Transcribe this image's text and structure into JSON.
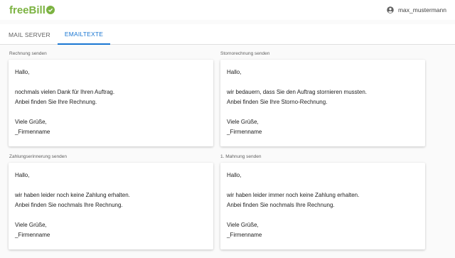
{
  "header": {
    "logo_free": "free",
    "logo_bill": "Bill",
    "username": "max_mustermann"
  },
  "tabs": [
    {
      "label": "MAIL SERVER",
      "active": false
    },
    {
      "label": "EMAILTEXTE",
      "active": true
    }
  ],
  "templates": [
    {
      "label": "Rechnung senden",
      "greeting": "Hallo,",
      "line1": "nochmals vielen Dank für Ihren Auftrag.",
      "line2": "Anbei finden Sie Ihre Rechnung.",
      "closing": "Viele Grüße,",
      "signature": "_Firmenname"
    },
    {
      "label": "Stornorechnung senden",
      "greeting": "Hallo,",
      "line1": "wir bedauern, dass Sie den Auftrag stornieren mussten.",
      "line2": "Anbei finden Sie Ihre Storno-Rechnung.",
      "closing": "Viele Grüße,",
      "signature": "_Firmenname"
    },
    {
      "label": "Zahlungserinnerung senden",
      "greeting": "Hallo,",
      "line1": "wir haben leider noch keine Zahlung erhalten.",
      "line2": "Anbei finden Sie nochmals Ihre Rechnung.",
      "closing": "Viele Grüße,",
      "signature": "_Firmenname"
    },
    {
      "label": "1. Mahnung senden",
      "greeting": "Hallo,",
      "line1": "wir haben leider immer noch keine Zahlung erhalten.",
      "line2": "Anbei finden Sie nochmals Ihre Rechnung.",
      "closing": "Viele Grüße,",
      "signature": "_Firmenname"
    }
  ],
  "colors": {
    "brand": "#7cb342",
    "accent": "#1976d2"
  }
}
